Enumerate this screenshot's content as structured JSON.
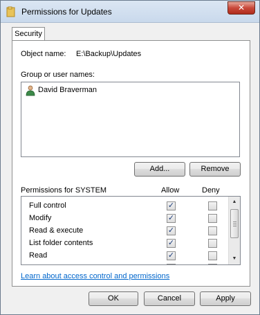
{
  "window": {
    "title": "Permissions for Updates",
    "close_glyph": "✕"
  },
  "tabs": [
    {
      "label": "Security"
    }
  ],
  "object": {
    "label": "Object name:",
    "value": "E:\\Backup\\Updates"
  },
  "groups": {
    "label": "Group or user names:",
    "users": [
      {
        "name": "David Braverman",
        "icon": "user-icon"
      }
    ],
    "add_label": "Add...",
    "remove_label": "Remove"
  },
  "permissions": {
    "label": "Permissions for SYSTEM",
    "allow_label": "Allow",
    "deny_label": "Deny",
    "rows": [
      {
        "name": "Full control",
        "allow": true,
        "deny": false
      },
      {
        "name": "Modify",
        "allow": true,
        "deny": false
      },
      {
        "name": "Read & execute",
        "allow": true,
        "deny": false
      },
      {
        "name": "List folder contents",
        "allow": true,
        "deny": false
      },
      {
        "name": "Read",
        "allow": true,
        "deny": false
      },
      {
        "name": "",
        "allow": true,
        "deny": false
      }
    ]
  },
  "link": {
    "text": "Learn about access control and permissions"
  },
  "buttons": {
    "ok": "OK",
    "cancel": "Cancel",
    "apply": "Apply"
  }
}
